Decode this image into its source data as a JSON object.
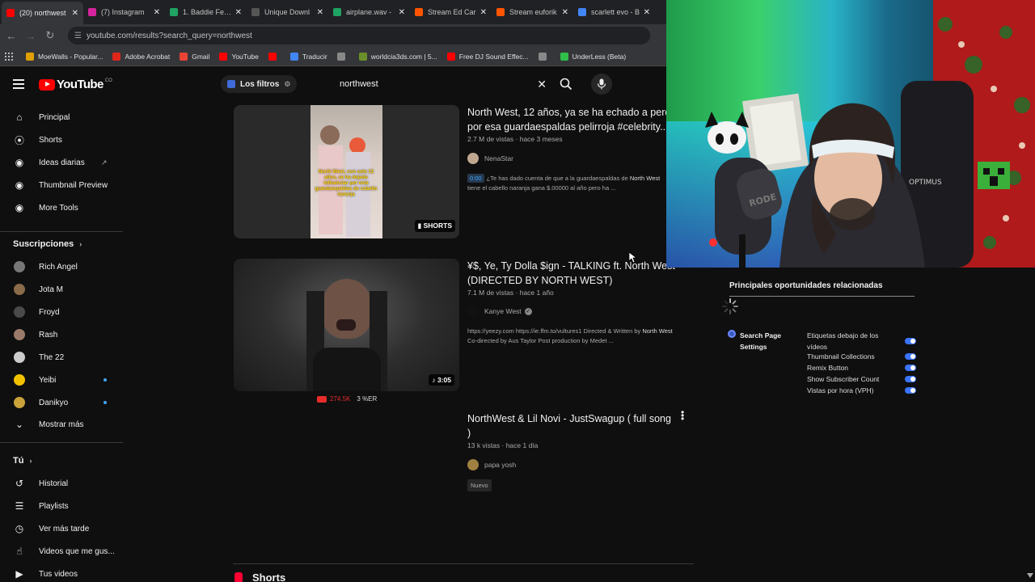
{
  "browser": {
    "tabs": [
      {
        "label": "(20) northwest",
        "color": "#ff0000",
        "active": true
      },
      {
        "label": "(7) Instagram",
        "color": "#d6249f"
      },
      {
        "label": "1. Baddie Feat.",
        "color": "#1ea362"
      },
      {
        "label": "Unique Downl",
        "color": "#555555"
      },
      {
        "label": "airplane.wav -",
        "color": "#1ea362"
      },
      {
        "label": "Stream Ed Car",
        "color": "#ff5500"
      },
      {
        "label": "Stream euforik",
        "color": "#ff5500"
      },
      {
        "label": "scarlett evo - B",
        "color": "#4285f4"
      }
    ],
    "url": "youtube.com/results?search_query=northwest",
    "bookmarks": [
      {
        "label": "MoeWalls - Popular...",
        "color": "#e0a000"
      },
      {
        "label": "Adobe Acrobat",
        "color": "#e0261b"
      },
      {
        "label": "Gmail",
        "color": "#ea4335"
      },
      {
        "label": "YouTube",
        "color": "#ff0000"
      },
      {
        "label": "",
        "color": "#ff0000"
      },
      {
        "label": "Traducir",
        "color": "#4285f4"
      },
      {
        "label": "",
        "color": "#888888"
      },
      {
        "label": "worldcia3ds.com | 5...",
        "color": "#6a8f2a"
      },
      {
        "label": "Free DJ Sound Effec...",
        "color": "#ff0000"
      },
      {
        "label": "",
        "color": "#888888"
      },
      {
        "label": "UnderLess (Beta)",
        "color": "#2fbf4a"
      }
    ]
  },
  "youtube": {
    "logo_text": "YouTube",
    "country": "CO",
    "filters_label": "Los filtros",
    "search_value": "northwest",
    "sidebar": {
      "main": [
        {
          "label": "Principal",
          "icon": "home-icon"
        },
        {
          "label": "Shorts",
          "icon": "shorts-icon"
        },
        {
          "label": "Ideas diarias",
          "icon": "ideas-icon"
        },
        {
          "label": "Thumbnail Preview",
          "icon": "thumbnail-icon"
        },
        {
          "label": "More Tools",
          "icon": "tools-icon"
        }
      ],
      "subs_heading": "Suscripciones",
      "subs": [
        {
          "label": "Rich Angel",
          "color": "#777777"
        },
        {
          "label": "Jota M",
          "color": "#8a6b4a"
        },
        {
          "label": "Froyd",
          "color": "#4a4a4a"
        },
        {
          "label": "Rash",
          "color": "#9a7b6a"
        },
        {
          "label": "The 22",
          "color": "#cccccc"
        },
        {
          "label": "Yeibi",
          "color": "#f2c200"
        },
        {
          "label": "Danikyo",
          "color": "#c9a23a"
        }
      ],
      "show_more": "Mostrar más",
      "you_heading": "Tú",
      "you": [
        {
          "label": "Historial",
          "icon": "history-icon"
        },
        {
          "label": "Playlists",
          "icon": "playlists-icon"
        },
        {
          "label": "Ver más tarde",
          "icon": "watch-later-icon"
        },
        {
          "label": "Videos que me gus...",
          "icon": "like-icon"
        },
        {
          "label": "Tus videos",
          "icon": "your-videos-icon"
        }
      ]
    },
    "results": [
      {
        "title_line1": "North West, 12 años, ya se ha echado a perder",
        "title_line2": "por esa guardaespaldas pelirroja #celebrity...",
        "meta": "2.7 M de vistas · hace 3 meses",
        "channel": "NenaStar",
        "timestamp": "0:00",
        "desc_line1_pre": "¿Te has dado cuenta de que a la guardaespaldas de ",
        "desc_line1_bold": "North West",
        "desc_line2": "tiene el cabello naranja gana $.00000 al año pero ha ...",
        "badge": "SHORTS",
        "thumb_caption": "North West, con solo 12 años, se ha dejado influenciar por esta guardaespaldas de cabello naranja"
      },
      {
        "title_line1": "¥$, Ye, Ty Dolla $ign - TALKING ft. North West",
        "title_line2": "(DIRECTED BY NORTH WEST)",
        "meta": "7.1 M de vistas · hace 1 año",
        "channel": "Kanye West",
        "desc_line1_pre": "https://yeezy.com https://ie.ffm.to/vultures1 Directed & Written by ",
        "desc_line1_bold": "North West",
        "desc_line2": "Co-directed by Aus Taylor Post production by Medet ...",
        "duration": "3:05",
        "likes": "274.5K",
        "er": "3 %ER"
      },
      {
        "title_line1": "NorthWest & Lil Novi - JustSwagup ( full song",
        "title_line2": ")",
        "meta": "13 k vistas · hace 1 día",
        "channel": "papa yosh",
        "badge": "Nuevo"
      }
    ],
    "shorts_heading": "Shorts"
  },
  "extension": {
    "heading": "Principales oportunidades relacionadas",
    "search_settings": "Search Page Settings",
    "options": [
      "Etiquetas debajo de los vídeos",
      "Thumbnail Collections",
      "Remix Button",
      "Show Subscriber Count",
      "Vistas por hora (VPH)"
    ]
  },
  "webcam": {
    "microphone_brand": "RODE",
    "chair_brand": "OPTIMUS"
  }
}
